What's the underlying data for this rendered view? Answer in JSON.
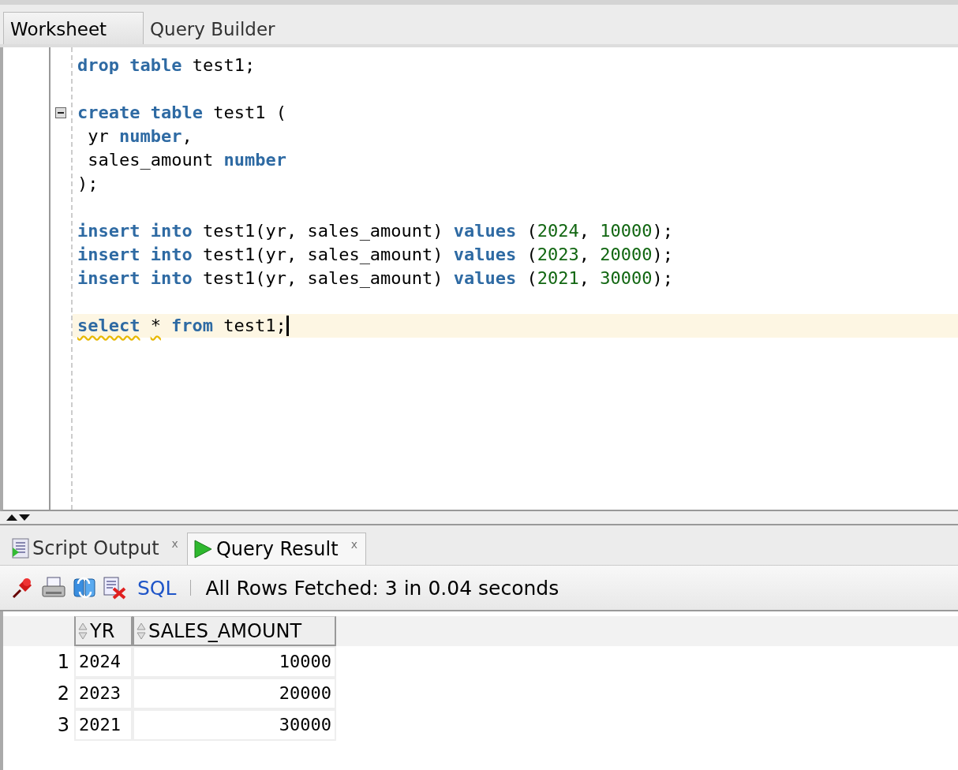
{
  "editor_tabs": [
    {
      "label": "Worksheet",
      "selected": true
    },
    {
      "label": "Query Builder",
      "selected": false
    }
  ],
  "code_lines": [
    {
      "fold_marker": false,
      "current": false,
      "tokens": [
        {
          "text": "drop table",
          "kind": "kw",
          "warn": false
        },
        {
          "text": " test1;",
          "kind": "text",
          "warn": false
        }
      ]
    },
    {
      "fold_marker": false,
      "current": false
    },
    {
      "fold_marker": true,
      "current": false,
      "tokens": [
        {
          "text": "create table",
          "kind": "kw",
          "warn": false
        },
        {
          "text": " test1 (",
          "kind": "text",
          "warn": false
        }
      ]
    },
    {
      "fold_marker": false,
      "current": false,
      "tokens": [
        {
          "text": " yr ",
          "kind": "text",
          "warn": false
        },
        {
          "text": "number",
          "kind": "kw",
          "warn": false
        },
        {
          "text": ",",
          "kind": "text",
          "warn": false
        }
      ]
    },
    {
      "fold_marker": false,
      "current": false,
      "tokens": [
        {
          "text": " sales_amount ",
          "kind": "text",
          "warn": false
        },
        {
          "text": "number",
          "kind": "kw",
          "warn": false
        }
      ]
    },
    {
      "fold_marker": false,
      "current": false,
      "tokens": [
        {
          "text": ");",
          "kind": "text",
          "warn": false
        }
      ]
    },
    {
      "fold_marker": false,
      "current": false
    },
    {
      "fold_marker": false,
      "current": false,
      "tokens": [
        {
          "text": "insert into",
          "kind": "kw",
          "warn": false
        },
        {
          "text": " test1(yr, sales_amount) ",
          "kind": "text",
          "warn": false
        },
        {
          "text": "values",
          "kind": "kw",
          "warn": false
        },
        {
          "text": " (",
          "kind": "text",
          "warn": false
        },
        {
          "text": "2024",
          "kind": "num",
          "warn": false
        },
        {
          "text": ", ",
          "kind": "text",
          "warn": false
        },
        {
          "text": "10000",
          "kind": "num",
          "warn": false
        },
        {
          "text": ");",
          "kind": "text",
          "warn": false
        }
      ]
    },
    {
      "fold_marker": false,
      "current": false,
      "tokens": [
        {
          "text": "insert into",
          "kind": "kw",
          "warn": false
        },
        {
          "text": " test1(yr, sales_amount) ",
          "kind": "text",
          "warn": false
        },
        {
          "text": "values",
          "kind": "kw",
          "warn": false
        },
        {
          "text": " (",
          "kind": "text",
          "warn": false
        },
        {
          "text": "2023",
          "kind": "num",
          "warn": false
        },
        {
          "text": ", ",
          "kind": "text",
          "warn": false
        },
        {
          "text": "20000",
          "kind": "num",
          "warn": false
        },
        {
          "text": ");",
          "kind": "text",
          "warn": false
        }
      ]
    },
    {
      "fold_marker": false,
      "current": false,
      "tokens": [
        {
          "text": "insert into",
          "kind": "kw",
          "warn": false
        },
        {
          "text": " test1(yr, sales_amount) ",
          "kind": "text",
          "warn": false
        },
        {
          "text": "values",
          "kind": "kw",
          "warn": false
        },
        {
          "text": " (",
          "kind": "text",
          "warn": false
        },
        {
          "text": "2021",
          "kind": "num",
          "warn": false
        },
        {
          "text": ", ",
          "kind": "text",
          "warn": false
        },
        {
          "text": "30000",
          "kind": "num",
          "warn": false
        },
        {
          "text": ");",
          "kind": "text",
          "warn": false
        }
      ]
    },
    {
      "fold_marker": false,
      "current": false
    },
    {
      "fold_marker": false,
      "current": true,
      "tokens": [
        {
          "text": "select",
          "kind": "kw",
          "warn": true
        },
        {
          "text": "*",
          "kind": "text",
          "warn": true
        },
        {
          "text": "from",
          "kind": "kw",
          "warn": false
        },
        {
          "text": " test1;",
          "kind": "text",
          "warn": false
        }
      ]
    }
  ],
  "output_tabs": [
    {
      "label": "Script Output",
      "close": "x",
      "kind": "script",
      "selected": false
    },
    {
      "label": "Query Result",
      "close": "x",
      "kind": "result",
      "selected": true
    }
  ],
  "toolbar": {
    "sql_link": "SQL",
    "status": "All Rows Fetched: 3 in 0.04 seconds"
  },
  "table": {
    "columns": [
      "YR",
      "SALES_AMOUNT"
    ],
    "rows": [
      {
        "number": "1",
        "cells": [
          "2024",
          "10000"
        ]
      },
      {
        "number": "2",
        "cells": [
          "2023",
          "20000"
        ]
      },
      {
        "number": "3",
        "cells": [
          "2021",
          "30000"
        ]
      }
    ]
  }
}
